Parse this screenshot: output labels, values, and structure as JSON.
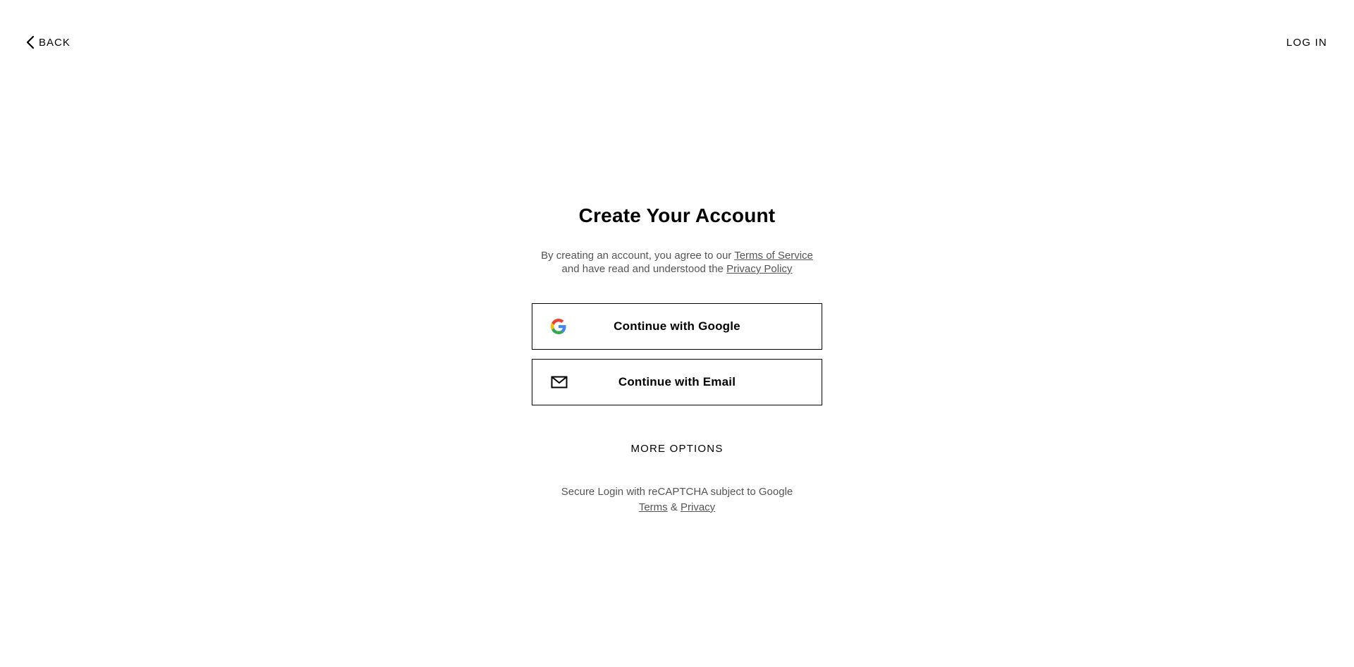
{
  "header": {
    "back_label": "BACK",
    "login_label": "LOG IN"
  },
  "main": {
    "title": "Create Your Account",
    "legal": {
      "line1_prefix": "By creating an account, you agree to our ",
      "terms_link": "Terms of Service",
      "line2_prefix": "and have read and understood the ",
      "privacy_link": "Privacy Policy"
    },
    "google_button_label": "Continue with Google",
    "email_button_label": "Continue with Email",
    "more_options_label": "MORE OPTIONS",
    "recaptcha": {
      "line1": "Secure Login with reCAPTCHA subject to Google",
      "terms_link": "Terms",
      "separator": " & ",
      "privacy_link": "Privacy"
    }
  },
  "icons": {
    "back": "chevron-left-icon",
    "google": "google-logo-icon",
    "email": "envelope-icon"
  },
  "colors": {
    "text": "#000000",
    "muted": "#555555",
    "border": "#000000",
    "background": "#ffffff"
  }
}
